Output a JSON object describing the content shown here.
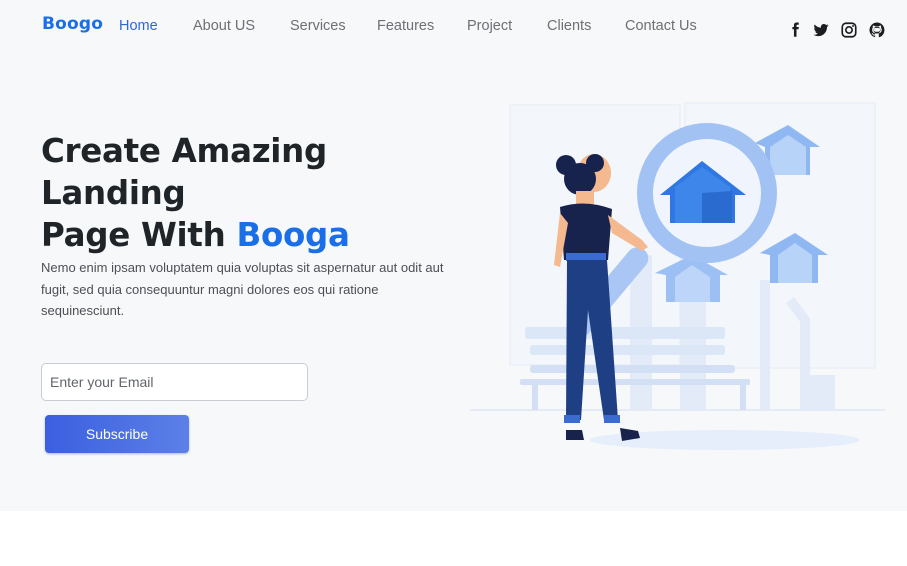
{
  "nav": {
    "logo": "Boogo",
    "items": [
      {
        "label": "Home",
        "active": true
      },
      {
        "label": "About US"
      },
      {
        "label": "Services"
      },
      {
        "label": "Features"
      },
      {
        "label": "Project"
      },
      {
        "label": "Clients"
      },
      {
        "label": "Contact Us"
      }
    ],
    "social": [
      "facebook-icon",
      "twitter-icon",
      "instagram-icon",
      "github-icon"
    ]
  },
  "hero": {
    "headline_line1": "Create Amazing Landing",
    "headline_line2_prefix": "Page With ",
    "headline_accent": "Booga",
    "description": "Nemo enim ipsam voluptatem quia voluptas sit aspernatur aut odit aut fugit, sed quia consequuntur magni dolores eos qui ratione sequinesciunt.",
    "email_placeholder": "Enter your Email",
    "subscribe_label": "Subscribe"
  },
  "colors": {
    "brand": "#1a6fe8",
    "nav_text": "#6e6f74",
    "nav_active": "#2f66d6",
    "hero_bg": "#f7f8fa",
    "button_start": "#3b5fe0",
    "button_end": "#5c80e6"
  }
}
